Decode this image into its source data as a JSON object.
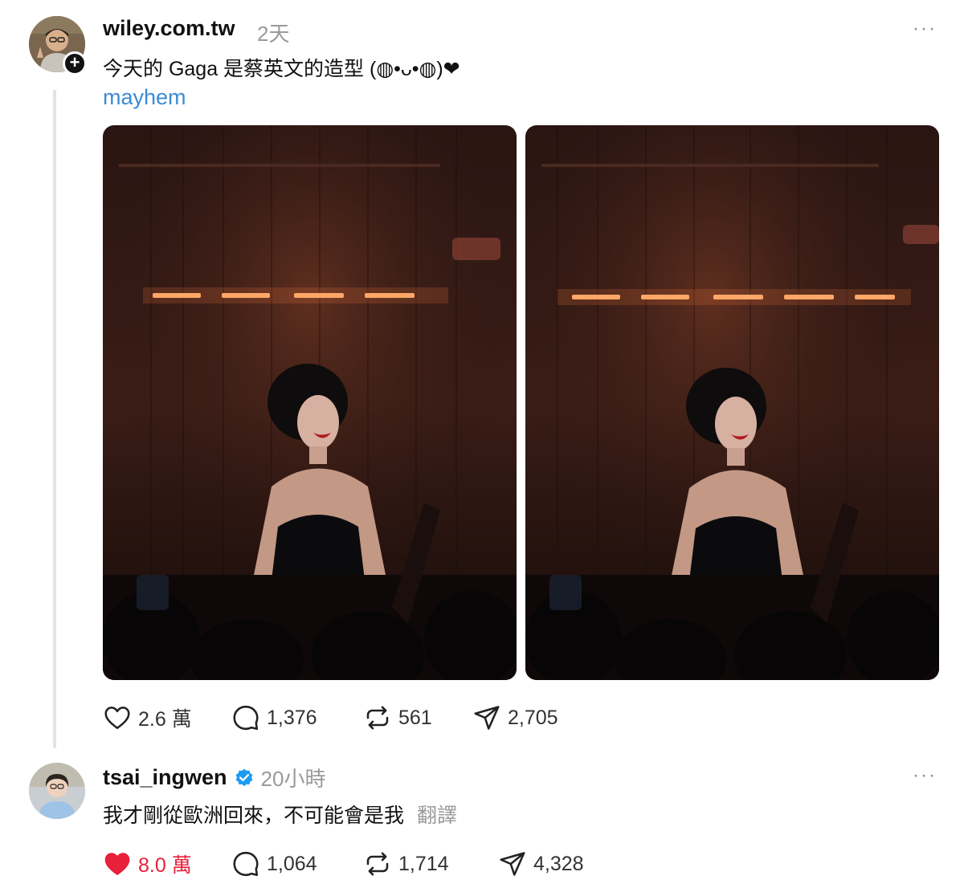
{
  "post": {
    "username": "wiley.com.tw",
    "time": "2天",
    "more": "···",
    "text": "今天的 Gaga 是蔡英文的造型 (◍•ᴗ•◍)❤",
    "tag": "mayhem",
    "avatar_icon": "person-avatar-icon",
    "actions": {
      "likes": "2.6 萬",
      "comments": "1,376",
      "reposts": "561",
      "shares": "2,705"
    }
  },
  "reply": {
    "username": "tsai_ingwen",
    "time": "20小時",
    "more": "···",
    "text": "我才剛從歐洲回來，不可能會是我",
    "translate": "翻譯",
    "actions": {
      "likes": "8.0 萬",
      "comments": "1,064",
      "reposts": "1,714",
      "shares": "4,328"
    }
  },
  "colors": {
    "link": "#3b8bd6",
    "liked": "#e8203a",
    "verified": "#1d9bf0"
  }
}
